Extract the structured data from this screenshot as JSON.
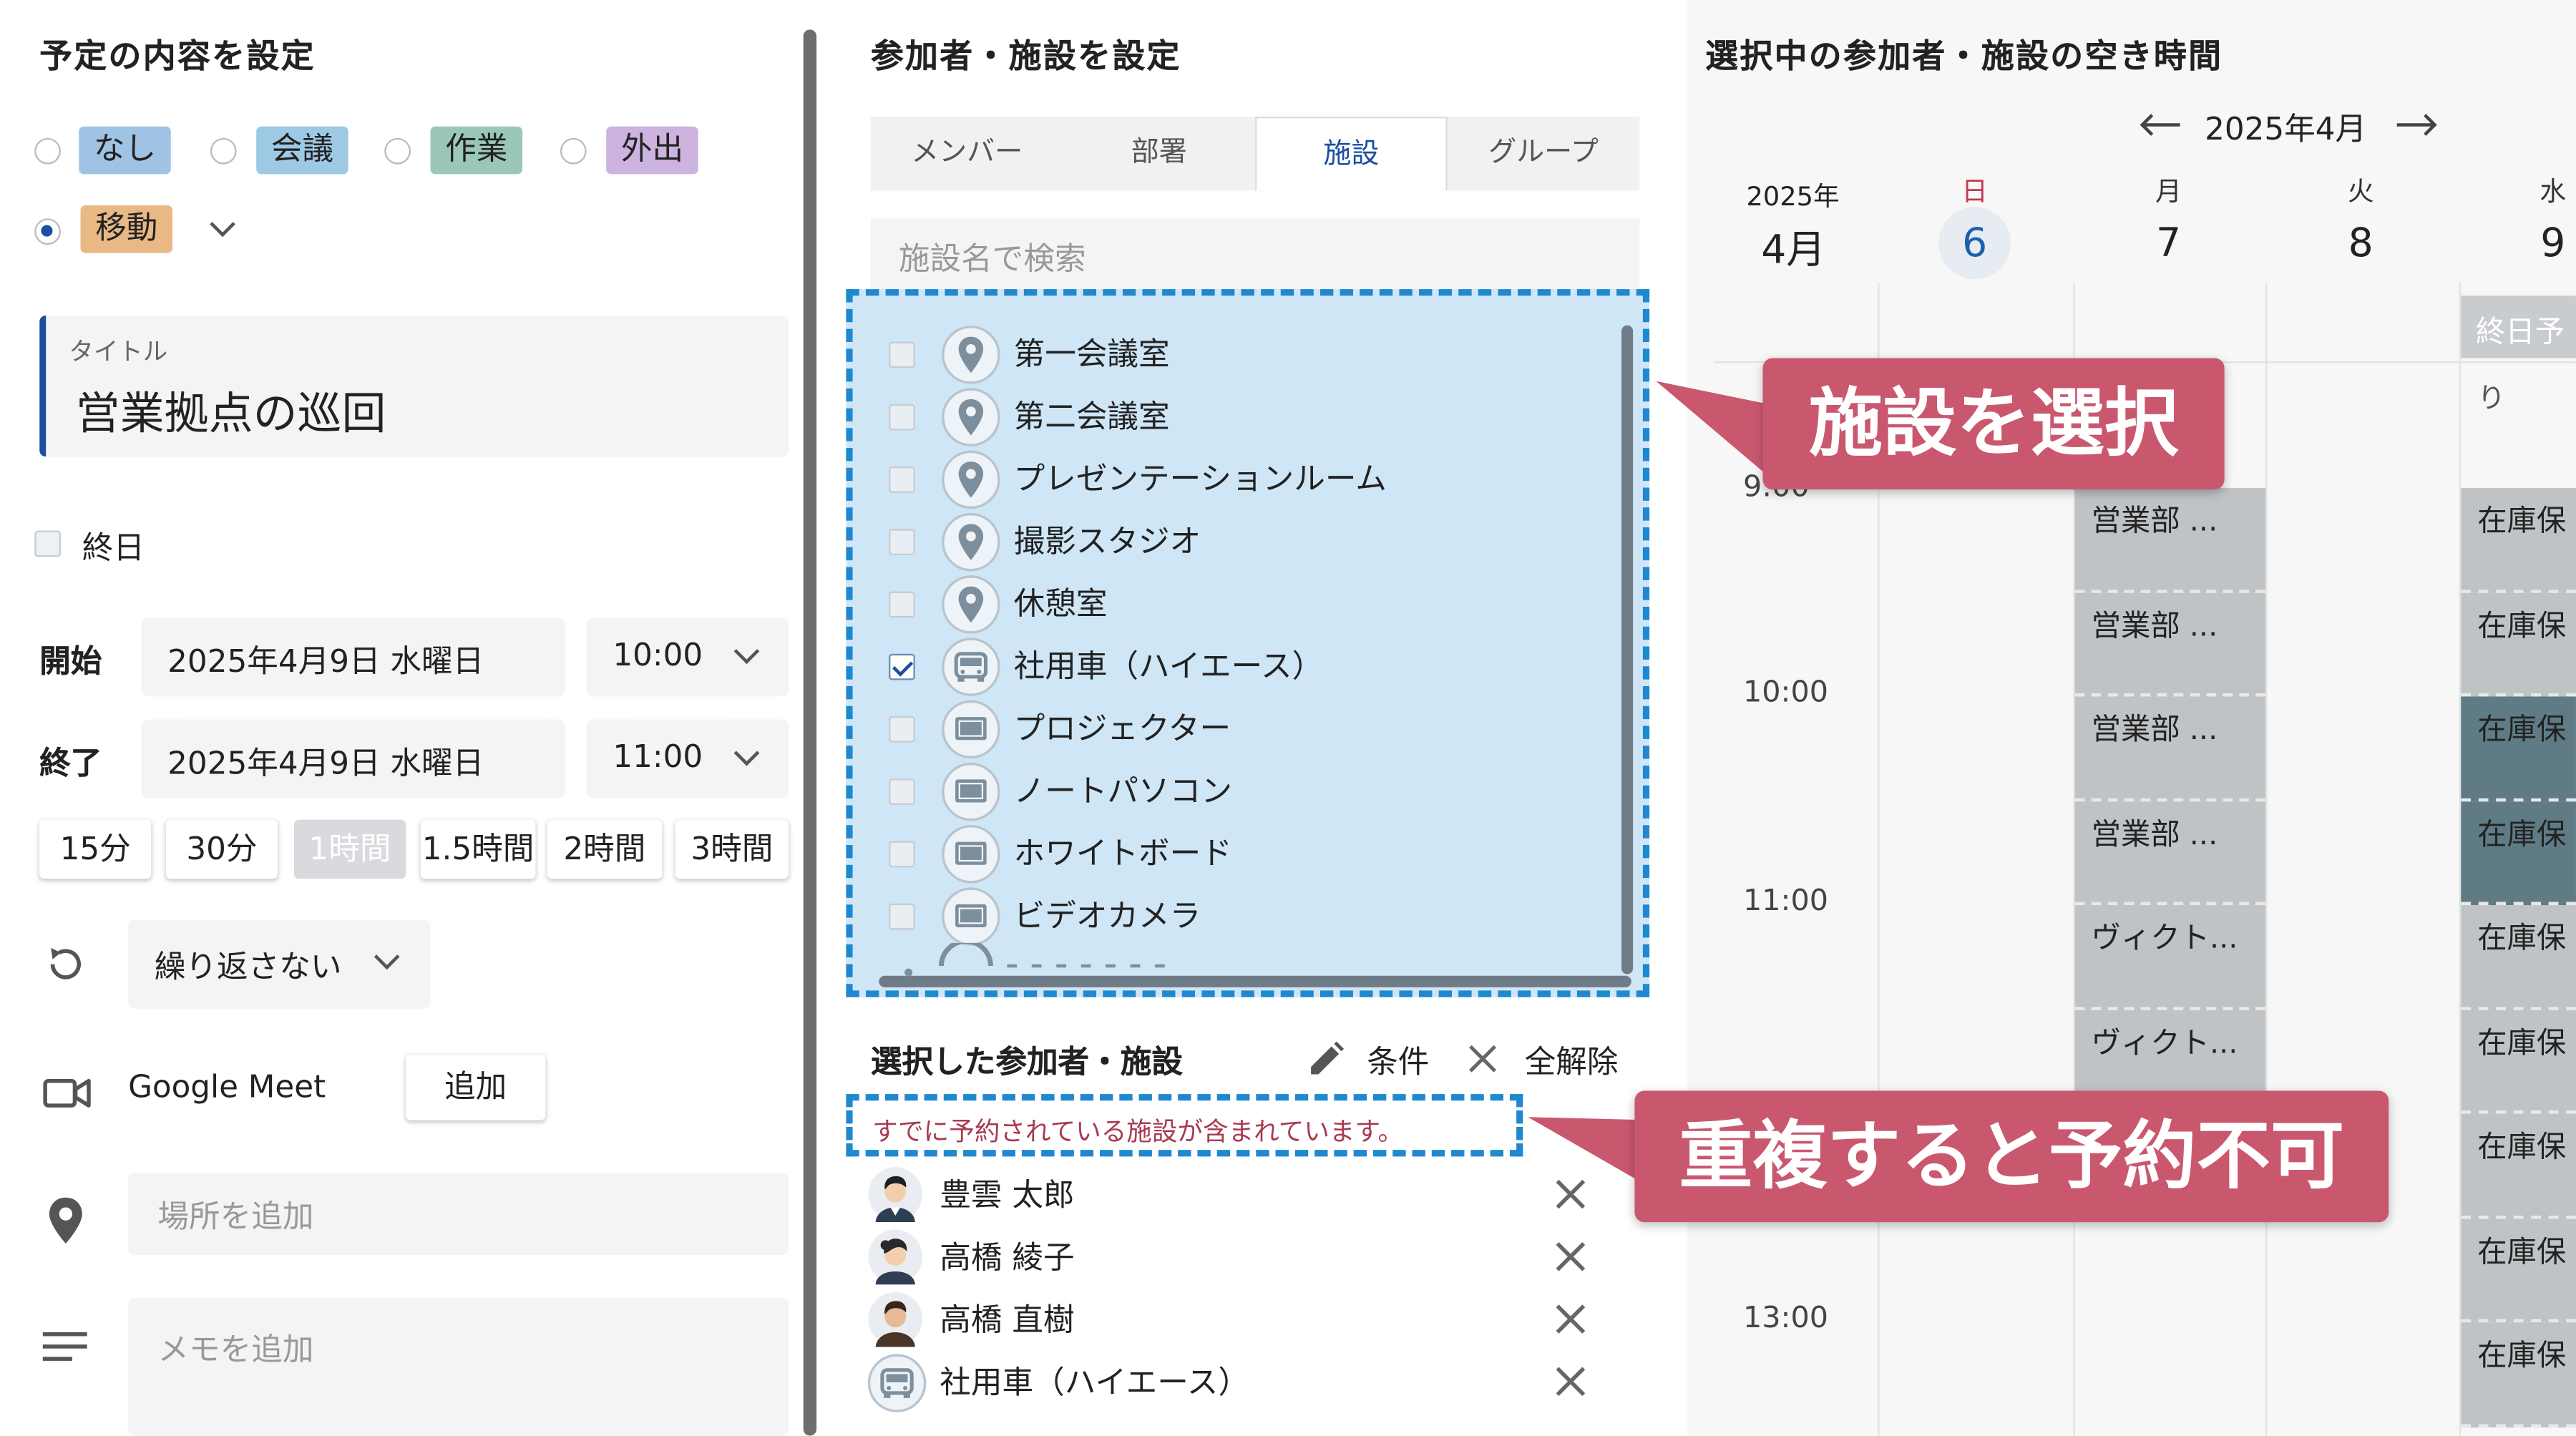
{
  "left": {
    "title": "予定の内容を設定",
    "categories": [
      {
        "label": "なし",
        "color": "#9fc4e3",
        "selected": false
      },
      {
        "label": "会議",
        "color": "#9ec9e4",
        "selected": false
      },
      {
        "label": "作業",
        "color": "#9bc7ba",
        "selected": false
      },
      {
        "label": "外出",
        "color": "#cdb3df",
        "selected": false
      },
      {
        "label": "移動",
        "color": "#e8b985",
        "selected": true
      }
    ],
    "title_field_label": "タイトル",
    "title_field_value": "営業拠点の巡回",
    "all_day_label": "終日",
    "start_label": "開始",
    "start_date": "2025年4月9日 水曜日",
    "start_time": "10:00",
    "end_label": "終了",
    "end_date": "2025年4月9日 水曜日",
    "end_time": "11:00",
    "durations": [
      "15分",
      "30分",
      "1時間",
      "1.5時間",
      "2時間",
      "3時間"
    ],
    "active_duration": "1時間",
    "repeat_label": "繰り返さない",
    "meet_label": "Google Meet",
    "meet_add_label": "追加",
    "location_placeholder": "場所を追加",
    "memo_placeholder": "メモを追加"
  },
  "middle": {
    "title": "参加者・施設を設定",
    "tabs": [
      "メンバー",
      "部署",
      "施設",
      "グループ"
    ],
    "active_tab": "施設",
    "search_placeholder": "施設名で検索",
    "facilities": [
      {
        "name": "第一会議室",
        "icon": "location-pin-icon",
        "checked": false
      },
      {
        "name": "第二会議室",
        "icon": "location-pin-icon",
        "checked": false
      },
      {
        "name": "プレゼンテーションルーム",
        "icon": "location-pin-icon",
        "checked": false
      },
      {
        "name": "撮影スタジオ",
        "icon": "location-pin-icon",
        "checked": false
      },
      {
        "name": "休憩室",
        "icon": "location-pin-icon",
        "checked": false
      },
      {
        "name": "社用車（ハイエース）",
        "icon": "car-icon",
        "checked": true
      },
      {
        "name": "プロジェクター",
        "icon": "device-icon",
        "checked": false
      },
      {
        "name": "ノートパソコン",
        "icon": "device-icon",
        "checked": false
      },
      {
        "name": "ホワイトボード",
        "icon": "device-icon",
        "checked": false
      },
      {
        "name": "ビデオカメラ",
        "icon": "device-icon",
        "checked": false
      }
    ],
    "selected_title": "選択した参加者・施設",
    "conditions_label": "条件",
    "clear_all_label": "全解除",
    "warning": "すでに予約されている施設が含まれています。",
    "selected": [
      {
        "name": "豊雲 太郎",
        "icon": "avatar-male-icon"
      },
      {
        "name": "高橋 綾子",
        "icon": "avatar-female-icon"
      },
      {
        "name": "高橋 直樹",
        "icon": "avatar-male2-icon"
      },
      {
        "name": "社用車（ハイエース）",
        "icon": "car-icon"
      }
    ]
  },
  "callouts": {
    "select_facility": "施設を選択",
    "duplicate": "重複すると予約不可"
  },
  "calendar": {
    "title": "選択中の参加者・施設の空き時間",
    "month_nav": "2025年4月",
    "year_label": "2025年",
    "month_label": "4月",
    "days": [
      {
        "name": "日",
        "num": "6",
        "today": true
      },
      {
        "name": "月",
        "num": "7",
        "today": false
      },
      {
        "name": "火",
        "num": "8",
        "today": false
      },
      {
        "name": "水",
        "num": "9",
        "today": false
      }
    ],
    "allday_event": "終日予",
    "allday_continue": "り",
    "partial_time": "9:00",
    "times": [
      "10:00",
      "11:00",
      "13:00"
    ],
    "mon_events": [
      "営業部 ...",
      "営業部 ...",
      "営業部 ...",
      "営業部 ...",
      "ヴィクト...",
      "ヴィクト..."
    ],
    "wed_events": [
      "在庫保",
      "在庫保",
      "在庫保",
      "在庫保",
      "在庫保",
      "在庫保",
      "在庫保",
      "在庫保",
      "在庫保"
    ],
    "colors": {
      "event_gray": "#bfc3c6",
      "event_dark": "#5f7c86",
      "accent": "#c9586f",
      "brand_blue": "#1d4fa0"
    }
  }
}
